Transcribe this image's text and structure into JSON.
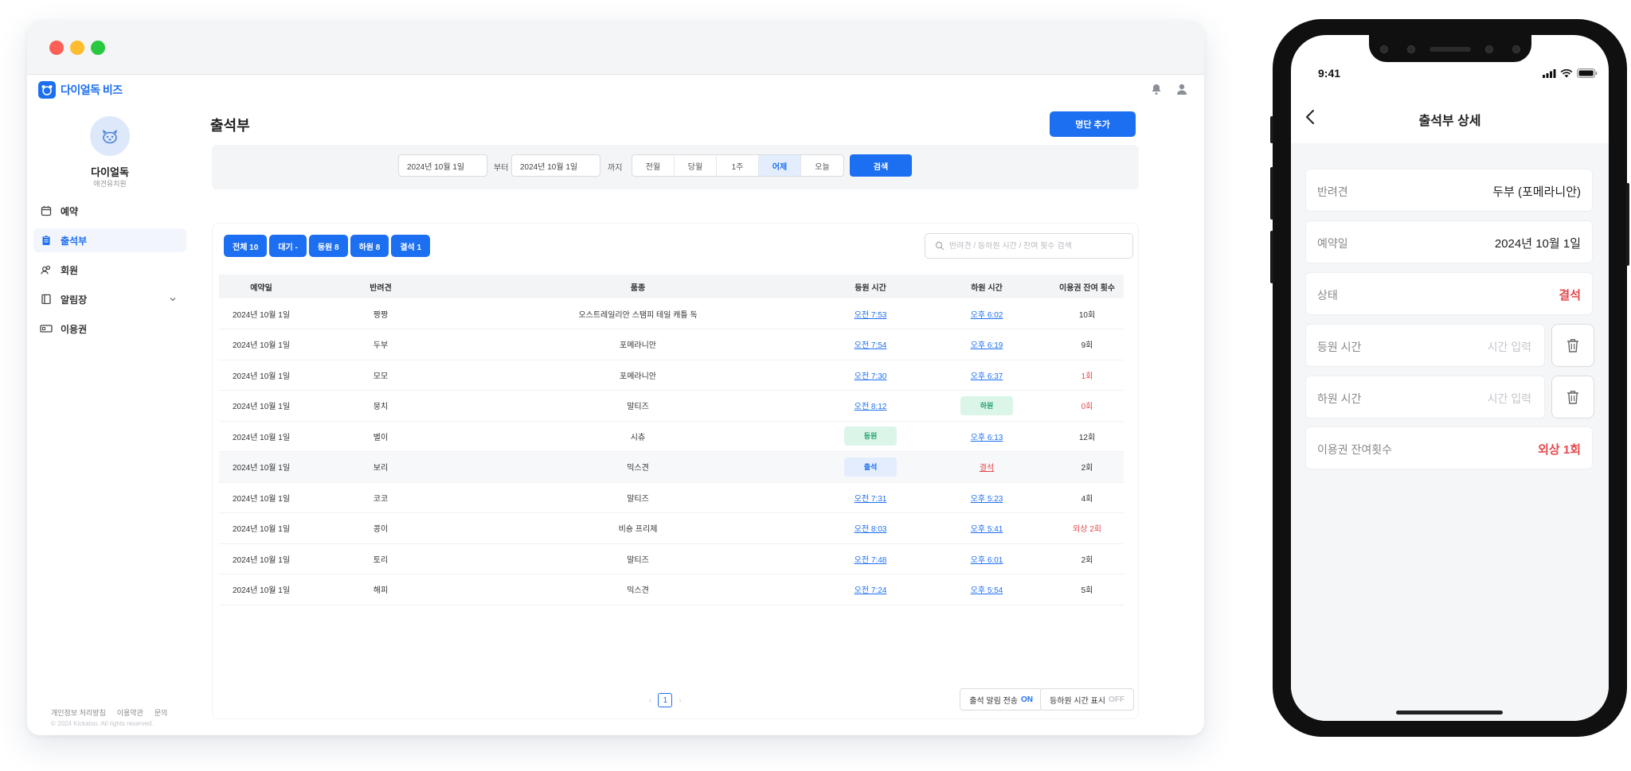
{
  "app": {
    "logo_text": "다이얼독 비즈"
  },
  "profile": {
    "name": "다이얼독",
    "subtitle": "애견유치원"
  },
  "sidebar": {
    "items": [
      {
        "label": "예약",
        "icon": "calendar-icon",
        "active": false
      },
      {
        "label": "출석부",
        "icon": "clipboard-icon",
        "active": true
      },
      {
        "label": "회원",
        "icon": "members-icon",
        "active": false
      },
      {
        "label": "알림장",
        "icon": "notebook-icon",
        "active": false,
        "has_submenu": true
      },
      {
        "label": "이용권",
        "icon": "ticket-icon",
        "active": false
      }
    ],
    "footer_links": [
      "개인정보 처리방침",
      "이용약관",
      "문의"
    ],
    "copyright": "© 2024 Kickaloo. All rights reserved."
  },
  "page": {
    "title": "출석부",
    "add_button": "명단 추가"
  },
  "filter": {
    "start_date": "2024년 10월 1일",
    "from_label": "부터",
    "end_date": "2024년 10월 1일",
    "to_label": "까지",
    "ranges": [
      "전월",
      "당월",
      "1주",
      "어제",
      "오늘"
    ],
    "selected_range": "어제",
    "search_button": "검색"
  },
  "status_chips": [
    "전체 10",
    "대기 -",
    "등원 8",
    "하원 8",
    "결석 1"
  ],
  "table_search": {
    "placeholder": "반려견 / 등하원 시간 / 잔여 횟수 검색"
  },
  "table": {
    "headers": [
      "예약일",
      "반려견",
      "품종",
      "등원 시간",
      "하원 시간",
      "이용권 잔여 횟수"
    ],
    "rows": [
      {
        "date": "2024년 10월 1일",
        "dog": "짱짱",
        "breed": "오스트레일리안 스탬피 테일 캐틀 독",
        "checkin": "오전 7:53",
        "checkout": "오후 6:02",
        "remaining": "10회"
      },
      {
        "date": "2024년 10월 1일",
        "dog": "두부",
        "breed": "포메라니안",
        "checkin": "오전 7:54",
        "checkout": "오후 6:19",
        "remaining": "9회"
      },
      {
        "date": "2024년 10월 1일",
        "dog": "모모",
        "breed": "포메라니안",
        "checkin": "오전 7:30",
        "checkout": "오후 6:37",
        "remaining": "1회"
      },
      {
        "date": "2024년 10월 1일",
        "dog": "뭉치",
        "breed": "말티즈",
        "checkin": "오전 8:12",
        "checkout": "하원",
        "remaining": "0회"
      },
      {
        "date": "2024년 10월 1일",
        "dog": "별이",
        "breed": "시츄",
        "checkin": "등원",
        "checkout": "오후 6:13",
        "remaining": "12회"
      },
      {
        "date": "2024년 10월 1일",
        "dog": "보리",
        "breed": "믹스견",
        "checkin": "출석",
        "checkout": "결석",
        "remaining": "2회"
      },
      {
        "date": "2024년 10월 1일",
        "dog": "코코",
        "breed": "말티즈",
        "checkin": "오전 7:31",
        "checkout": "오후 5:23",
        "remaining": "4회"
      },
      {
        "date": "2024년 10월 1일",
        "dog": "콩이",
        "breed": "비숑 프리제",
        "checkin": "오전 8:03",
        "checkout": "오후 5:41",
        "remaining": "외상 2회"
      },
      {
        "date": "2024년 10월 1일",
        "dog": "토리",
        "breed": "말티즈",
        "checkin": "오전 7:48",
        "checkout": "오후 6:01",
        "remaining": "2회"
      },
      {
        "date": "2024년 10월 1일",
        "dog": "해피",
        "breed": "믹스견",
        "checkin": "오전 7:24",
        "checkout": "오후 5:54",
        "remaining": "5회"
      }
    ]
  },
  "pagination": {
    "current": "1",
    "prev": "‹",
    "next": "›"
  },
  "toggles": {
    "notify_label": "출석 알림 전송",
    "notify_state": "ON",
    "time_label": "등하원 시간 표시",
    "time_state": "OFF"
  },
  "mobile": {
    "status_time": "9:41",
    "title": "출석부 상세",
    "rows": {
      "dog_label": "반려견",
      "dog_value": "두부 (포메라니안)",
      "date_label": "예약일",
      "date_value": "2024년 10월 1일",
      "status_label": "상태",
      "status_value": "결석",
      "checkin_label": "등원 시간",
      "checkin_placeholder": "시간 입력",
      "checkout_label": "하원 시간",
      "checkout_placeholder": "시간 입력",
      "remaining_label": "이용권 잔여횟수",
      "remaining_value": "외상 1회"
    }
  },
  "colors": {
    "accent": "#1d6ff2",
    "danger": "#e5484d",
    "success": "#22a06b"
  }
}
